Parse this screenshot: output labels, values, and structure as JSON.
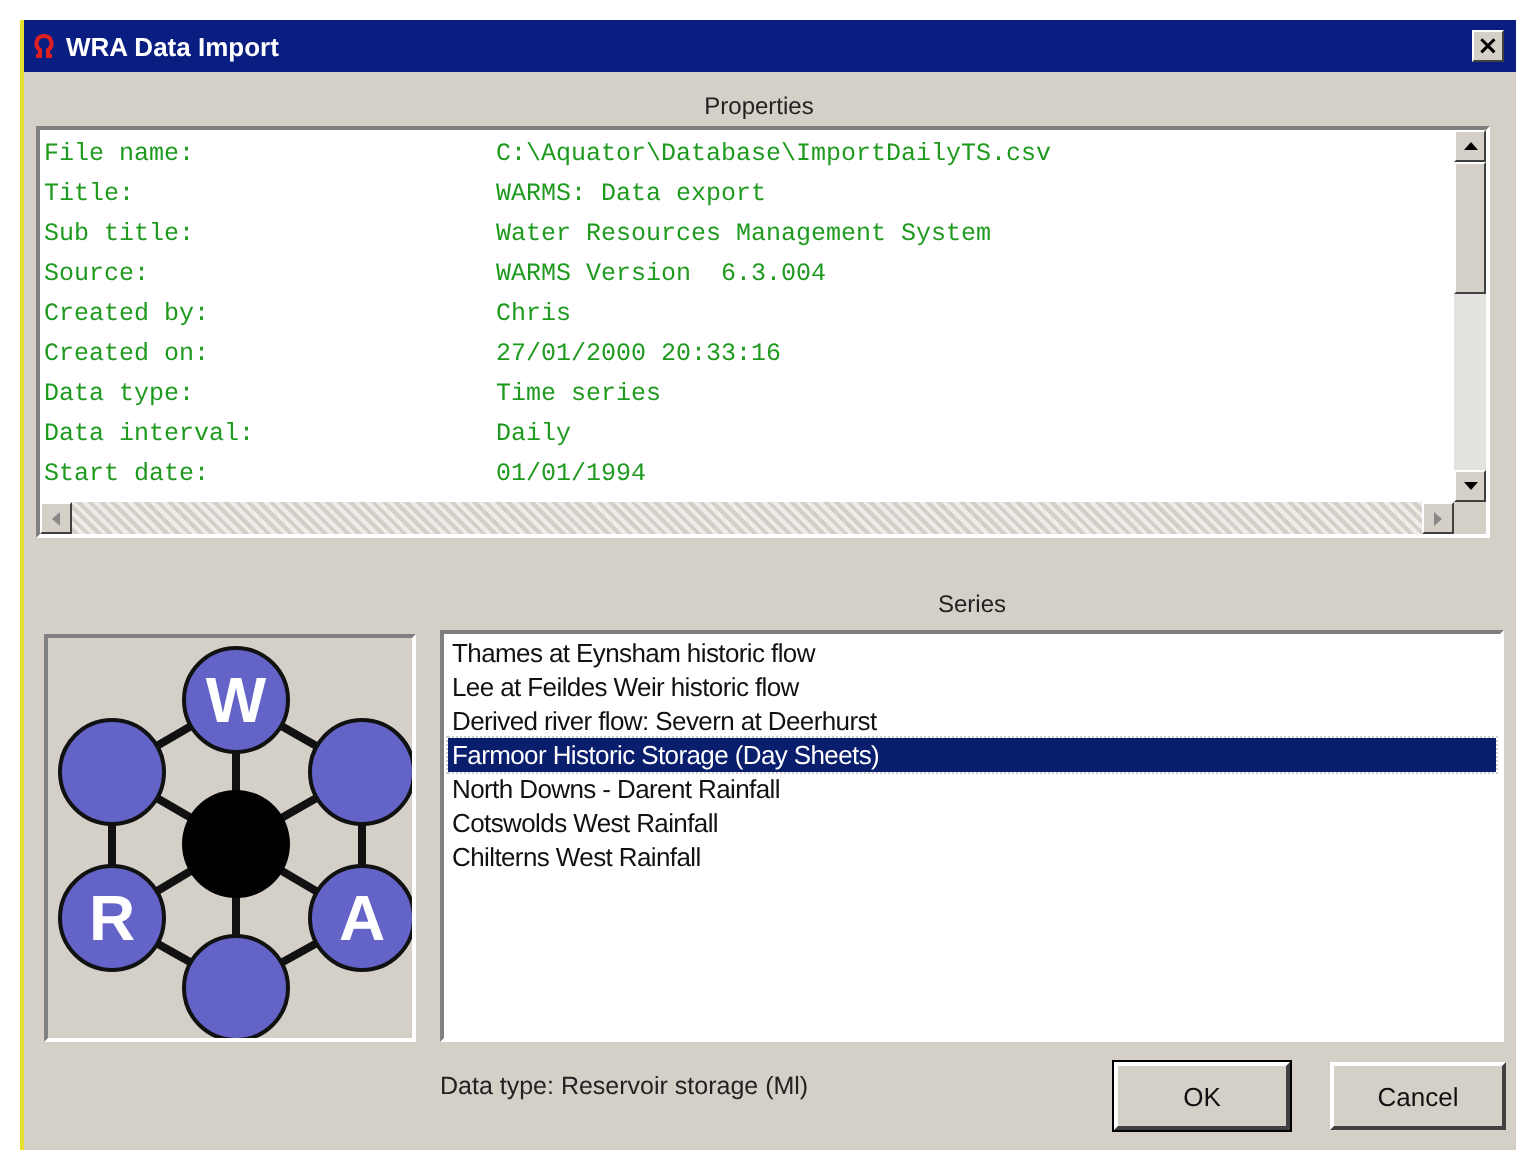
{
  "window": {
    "title": "WRA Data Import",
    "close_glyph": "×"
  },
  "properties": {
    "heading": "Properties",
    "rows": [
      {
        "label": "File name:",
        "value": "C:\\Aquator\\Database\\ImportDailyTS.csv"
      },
      {
        "label": "Title:",
        "value": "WARMS: Data export"
      },
      {
        "label": "Sub title:",
        "value": "Water Resources Management System"
      },
      {
        "label": "Source:",
        "value": "WARMS Version  6.3.004"
      },
      {
        "label": "Created by:",
        "value": "Chris"
      },
      {
        "label": "Created on:",
        "value": "27/01/2000 20:33:16"
      },
      {
        "label": "Data type:",
        "value": "Time series"
      },
      {
        "label": "Data interval:",
        "value": "Daily"
      },
      {
        "label": "Start date:",
        "value": "01/01/1994"
      }
    ]
  },
  "logo": {
    "letters": [
      "W",
      "R",
      "A"
    ]
  },
  "series": {
    "heading": "Series",
    "items": [
      {
        "name": "Thames at Eynsham historic flow",
        "selected": false
      },
      {
        "name": "Lee at Feildes Weir historic flow",
        "selected": false
      },
      {
        "name": "Derived river flow: Severn at Deerhurst",
        "selected": false
      },
      {
        "name": "Farmoor Historic Storage (Day Sheets)",
        "selected": true
      },
      {
        "name": "North Downs - Darent Rainfall",
        "selected": false
      },
      {
        "name": "Cotswolds West Rainfall",
        "selected": false
      },
      {
        "name": "Chilterns West Rainfall",
        "selected": false
      }
    ]
  },
  "status": "Data type: Reservoir storage (Ml)",
  "buttons": [
    "OK",
    "Cancel"
  ]
}
